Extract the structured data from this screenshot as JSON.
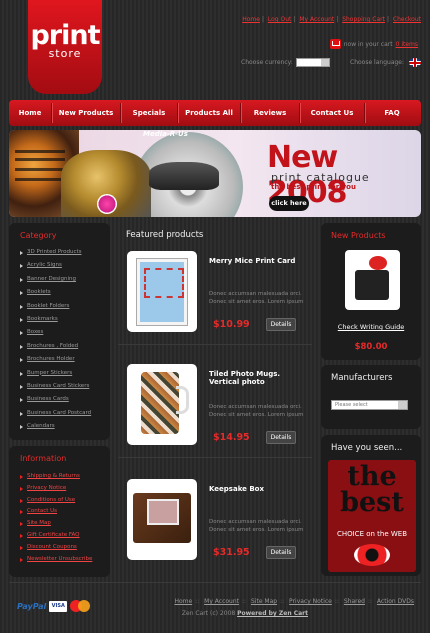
{
  "logo": {
    "word": "print",
    "sub": "store"
  },
  "toplinks": [
    "Home",
    "Log Out",
    "My Account",
    "Shopping Cart",
    "Checkout"
  ],
  "cart": {
    "text": "now in your cart",
    "count": "0 items"
  },
  "currency_label": "Choose currency:",
  "language_label": "Choose language:",
  "nav": [
    "Home",
    "New Products",
    "Specials",
    "Products All",
    "Reviews",
    "Contact Us",
    "FAQ"
  ],
  "banner": {
    "brand": "Media-R-Us",
    "headline": "New 2008",
    "subline": "print catalogue",
    "tagline": "the best print for you",
    "button": "click here"
  },
  "category": {
    "title": "Category",
    "items": [
      "3D Printed Products",
      "Acrylic Signs",
      "Banner Designing",
      "Booklets",
      "Booklet Folders",
      "Bookmarks",
      "Boxes",
      "Brochures , Folded",
      "Brochures Holder",
      "Bumper Stickers",
      "Business Card Stickers",
      "Business Cards",
      "Business Card Postcard",
      "Calendars"
    ]
  },
  "information": {
    "title": "Information",
    "items": [
      "Shipping & Returns",
      "Privacy Notice",
      "Conditions of Use",
      "Contact Us",
      "Site Map",
      "Gift Certificate FAQ",
      "Discount Coupons",
      "Newsletter Unsubscribe"
    ]
  },
  "featured": {
    "title": "Featured products",
    "details_label": "Details",
    "products": [
      {
        "name": "Merry Mice Print Card",
        "desc": "Donec accumsan malesuada orci. Donec sit amet eros. Lorem ipsum",
        "price": "$10.99"
      },
      {
        "name": "Tiled Photo Mugs. Vertical photo",
        "desc": "Donec accumsan malesuada orci. Donec sit amet eros. Lorem ipsum",
        "price": "$14.95"
      },
      {
        "name": "Keepsake Box",
        "desc": "Donec accumsan malesuada orci. Donec sit amet eros. Lorem ipsum",
        "price": "$31.95"
      }
    ]
  },
  "new_products": {
    "title": "New Products",
    "name": "Check Writing Guide",
    "price": "$80.00"
  },
  "manufacturers": {
    "title": "Manufacturers",
    "placeholder": "Please select"
  },
  "have_seen": {
    "title": "Have you seen...",
    "big": "the best",
    "small": "CHOICE on the WEB"
  },
  "footer": {
    "links": [
      "Home",
      "My Account",
      "Site Map",
      "Privacy Notice",
      "Shared",
      "Action DVDs"
    ],
    "copyright": "Zen Cart (c) 2008",
    "powered": "Powered by Zen Cart",
    "payments": {
      "paypal": "PayPal",
      "visa": "VISA",
      "mastercard": "MasterCard"
    }
  },
  "colors": {
    "accent": "#d81820",
    "background": "#2b2b2b",
    "panel": "#1c1c1c"
  }
}
